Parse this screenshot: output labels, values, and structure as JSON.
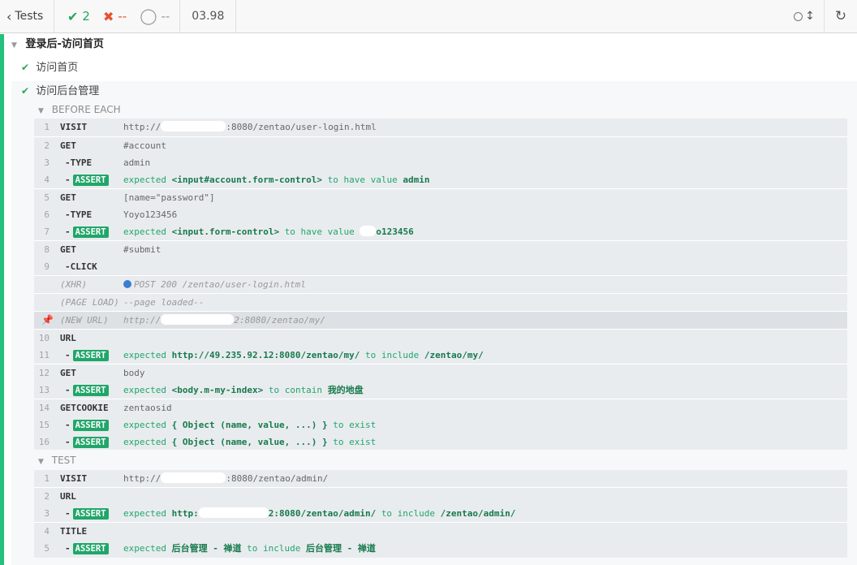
{
  "header": {
    "back_label": "Tests",
    "passed_count": "2",
    "failed_count": "--",
    "pending_count": "--",
    "duration": "03.98",
    "colors": {
      "passed": "#26a65b",
      "failed": "#e94f2e",
      "pending": "#999999",
      "accent": "#25c07b"
    }
  },
  "suite": {
    "title": "登录后-访问首页",
    "tests": [
      {
        "title": "访问首页"
      },
      {
        "title": "访问后台管理"
      }
    ]
  },
  "before_each": {
    "title": "BEFORE EACH",
    "rows": [
      {
        "num": "1",
        "cmd": "VISIT",
        "msg_pre": "http://",
        "msg_post": ":8080/zentao/user-login.html"
      },
      {
        "num": "2",
        "cmd": "GET",
        "msg": "#account"
      },
      {
        "num": "3",
        "cmd": "-TYPE",
        "msg": "admin"
      },
      {
        "num": "4",
        "badge": "ASSERT",
        "expected": "expected",
        "selector": "<input#account.form-control>",
        "verb": "to have value",
        "value": "admin"
      },
      {
        "num": "5",
        "cmd": "GET",
        "msg": "[name=\"password\"]"
      },
      {
        "num": "6",
        "cmd": "-TYPE",
        "msg": "Yoyo123456"
      },
      {
        "num": "7",
        "badge": "ASSERT",
        "expected": "expected",
        "selector": "<input.form-control>",
        "verb": "to have value",
        "value": "o123456"
      },
      {
        "num": "8",
        "cmd": "GET",
        "msg": "#submit"
      },
      {
        "num": "9",
        "cmd": "-CLICK"
      },
      {
        "cmd": "(XHR)",
        "msg": "POST 200 /zentao/user-login.html"
      },
      {
        "cmd": "(PAGE LOAD)",
        "msg": "--page loaded--"
      },
      {
        "cmd": "(NEW URL)",
        "msg_pre": "http://",
        "msg_post": "2:8080/zentao/my/"
      },
      {
        "num": "10",
        "cmd": "URL"
      },
      {
        "num": "11",
        "badge": "ASSERT",
        "expected": "expected",
        "selector": "http://49.235.92.12:8080/zentao/my/",
        "verb": "to include",
        "value": "/zentao/my/"
      },
      {
        "num": "12",
        "cmd": "GET",
        "msg": "body"
      },
      {
        "num": "13",
        "badge": "ASSERT",
        "expected": "expected",
        "selector": "<body.m-my-index>",
        "verb": "to contain",
        "value": "我的地盘"
      },
      {
        "num": "14",
        "cmd": "GETCOOKIE",
        "msg": "zentaosid"
      },
      {
        "num": "15",
        "badge": "ASSERT",
        "expected": "expected",
        "selector": "{ Object (name, value, ...) }",
        "verb": "to exist"
      },
      {
        "num": "16",
        "badge": "ASSERT",
        "expected": "expected",
        "selector": "{ Object (name, value, ...) }",
        "verb": "to exist"
      }
    ]
  },
  "test_section": {
    "title": "TEST",
    "rows": [
      {
        "num": "1",
        "cmd": "VISIT",
        "msg_pre": "http://",
        "msg_post": ":8080/zentao/admin/"
      },
      {
        "num": "2",
        "cmd": "URL"
      },
      {
        "num": "3",
        "badge": "ASSERT",
        "expected": "expected",
        "selector_pre": "http:",
        "selector_post": "2:8080/zentao/admin/",
        "verb": "to include",
        "value": "/zentao/admin/"
      },
      {
        "num": "4",
        "cmd": "TITLE"
      },
      {
        "num": "5",
        "badge": "ASSERT",
        "expected": "expected",
        "selector": "后台管理 - 禅道",
        "verb": "to include",
        "value": "后台管理 - 禅道"
      }
    ]
  }
}
